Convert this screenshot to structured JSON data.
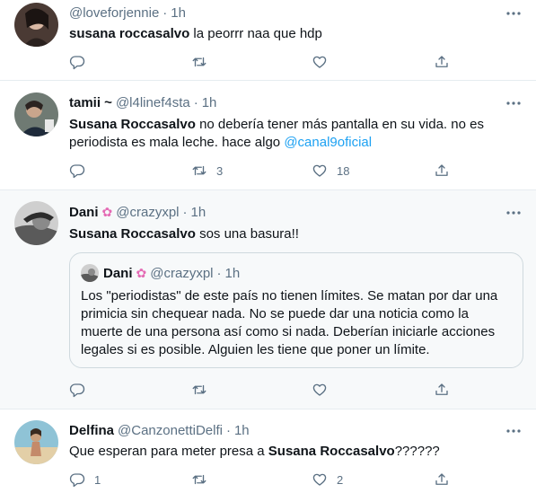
{
  "tweets": [
    {
      "display_name": "",
      "handle": "@loveforjennie",
      "dot": "·",
      "time": "1h",
      "segments": [
        {
          "text": "susana roccasalvo",
          "style": "bold"
        },
        {
          "text": " la peorrr naa que hdp",
          "style": "plain"
        }
      ],
      "reply_count": "",
      "retweet_count": "",
      "like_count": ""
    },
    {
      "display_name": "tamii ~",
      "handle": "@l4linef4sta",
      "dot": "·",
      "time": "1h",
      "segments": [
        {
          "text": "Susana Roccasalvo",
          "style": "bold"
        },
        {
          "text": " no debería tener más pantalla en su vida. no es",
          "style": "plain"
        },
        {
          "text": "\nperiodista es mala leche. hace algo ",
          "style": "plain"
        },
        {
          "text": "@canal9oficial",
          "style": "mention"
        }
      ],
      "reply_count": "",
      "retweet_count": "3",
      "like_count": "18"
    },
    {
      "display_name": "Dani",
      "emoji": "✿",
      "handle": "@crazyxpl",
      "dot": "·",
      "time": "1h",
      "segments": [
        {
          "text": "Susana Roccasalvo",
          "style": "bold"
        },
        {
          "text": " sos una basura!!",
          "style": "plain"
        }
      ],
      "quoted": {
        "display_name": "Dani",
        "emoji": "✿",
        "handle": "@crazyxpl",
        "dot": "·",
        "time": "1h",
        "lines": [
          "Los \"periodistas\" de este país no tienen límites. Se matan por dar una",
          "primicia sin chequear nada. No se puede dar una noticia como la",
          "muerte de una persona así como si nada. Deberían iniciarle acciones",
          "legales si es posible. Alguien les tiene que poner un límite."
        ]
      },
      "reply_count": "",
      "retweet_count": "",
      "like_count": ""
    },
    {
      "display_name": "Delfina",
      "handle": "@CanzonettiDelfi",
      "dot": "·",
      "time": "1h",
      "segments": [
        {
          "text": "Que esperan para meter presa a ",
          "style": "plain"
        },
        {
          "text": "Susana Roccasalvo",
          "style": "bold"
        },
        {
          "text": "??????",
          "style": "plain"
        }
      ],
      "reply_count": "1",
      "retweet_count": "",
      "like_count": "2"
    }
  ],
  "icons": {
    "reply": "reply-icon",
    "retweet": "retweet-icon",
    "like": "like-icon",
    "share": "share-icon",
    "more": "more-icon"
  },
  "colors": {
    "text": "#0f1419",
    "secondary": "#5b7083",
    "mention": "#1da1f2",
    "border": "#e6ecf0",
    "highlight_bg": "#f7f9fa"
  }
}
